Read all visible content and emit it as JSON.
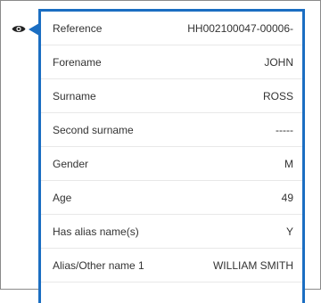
{
  "panel": {
    "rows": [
      {
        "label": "Reference",
        "value": "HH002100047-00006-"
      },
      {
        "label": "Forename",
        "value": "JOHN"
      },
      {
        "label": "Surname",
        "value": "ROSS"
      },
      {
        "label": "Second surname",
        "value": "-----"
      },
      {
        "label": "Gender",
        "value": "M"
      },
      {
        "label": "Age",
        "value": "49"
      },
      {
        "label": "Has alias name(s)",
        "value": "Y"
      },
      {
        "label": "Alias/Other name 1",
        "value": "WILLIAM SMITH"
      }
    ]
  },
  "icons": {
    "view": "eye-icon"
  },
  "colors": {
    "accent": "#1b6ec2",
    "text": "#333333",
    "divider": "#e8e8e8"
  }
}
